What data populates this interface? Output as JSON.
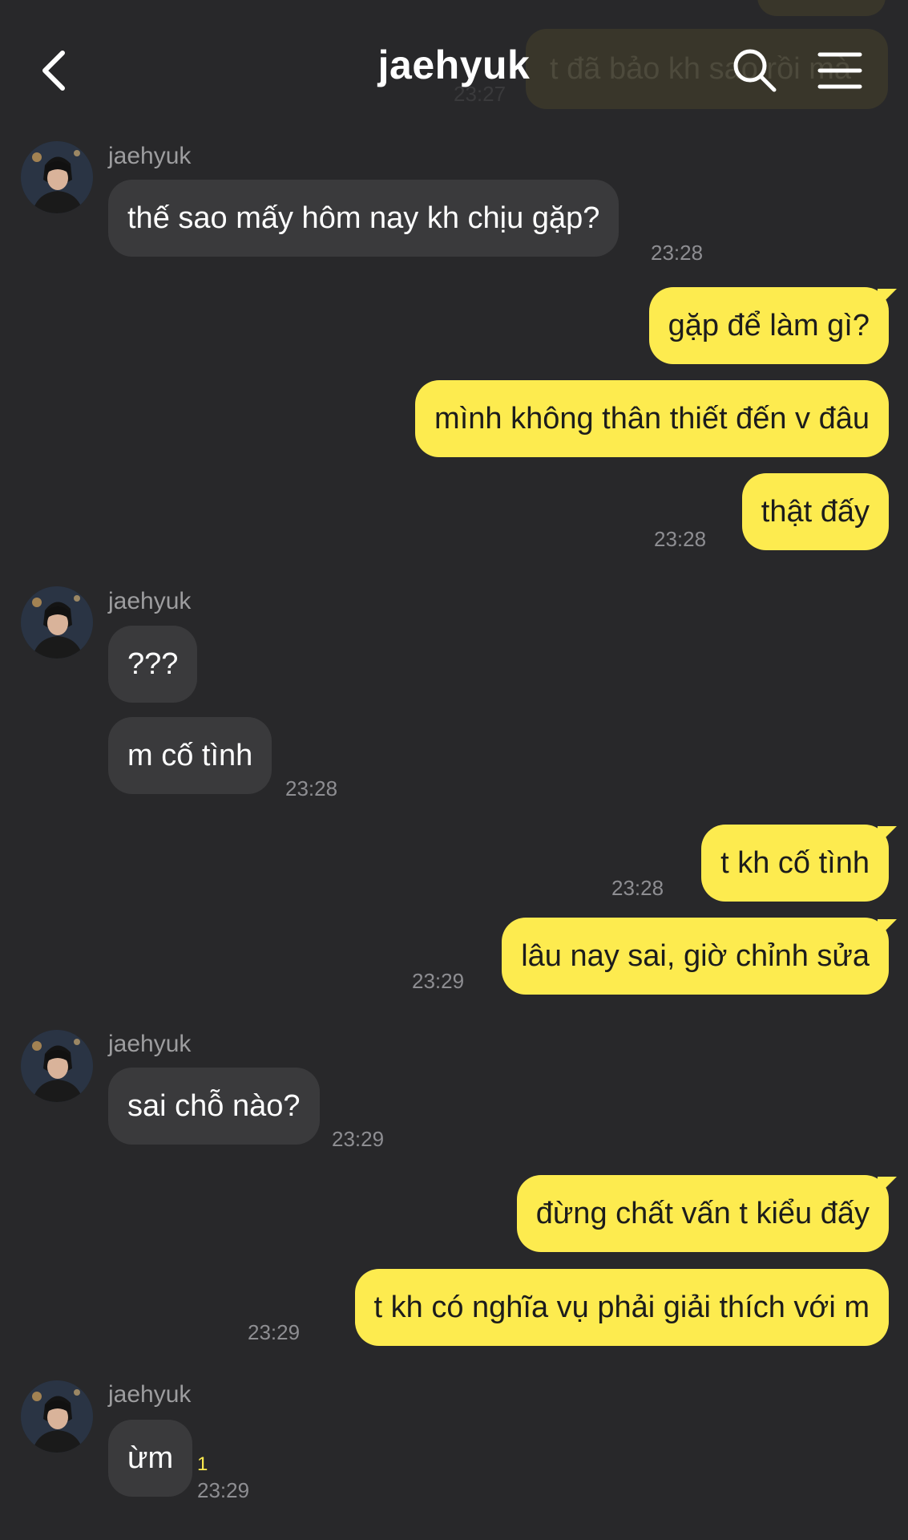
{
  "header": {
    "title": "jaehyuk",
    "back_icon": "chevron-left-icon",
    "search_icon": "search-icon",
    "menu_icon": "menu-icon"
  },
  "ghost": {
    "text": "t đã bảo kh sao rồi mà",
    "time": "23:27"
  },
  "colors": {
    "background": "#28282a",
    "incoming_bubble": "#3a3a3c",
    "outgoing_bubble": "#fdeb4f",
    "timestamp": "#8e8e92",
    "unread": "#fdeb4f"
  },
  "messages": [
    {
      "sender": "jaehyuk",
      "text": "thế sao mấy hôm nay kh chịu gặp?",
      "time": "23:28"
    },
    {
      "text": "gặp để làm gì?"
    },
    {
      "text": "mình không thân thiết đến v đâu"
    },
    {
      "text": "thật đấy",
      "time": "23:28"
    },
    {
      "sender": "jaehyuk",
      "text": "???"
    },
    {
      "text": "m cố tình",
      "time": "23:28"
    },
    {
      "text": "t kh cố tình",
      "time": "23:28"
    },
    {
      "text": "lâu nay sai, giờ chỉnh sửa",
      "time": "23:29"
    },
    {
      "sender": "jaehyuk",
      "text": "sai chỗ nào?",
      "time": "23:29"
    },
    {
      "text": "đừng chất vấn t kiểu đấy"
    },
    {
      "text": "t kh có nghĩa vụ phải giải thích với m",
      "time": "23:29"
    },
    {
      "sender": "jaehyuk",
      "text": "ừm",
      "time": "23:29",
      "unread": "1"
    }
  ]
}
